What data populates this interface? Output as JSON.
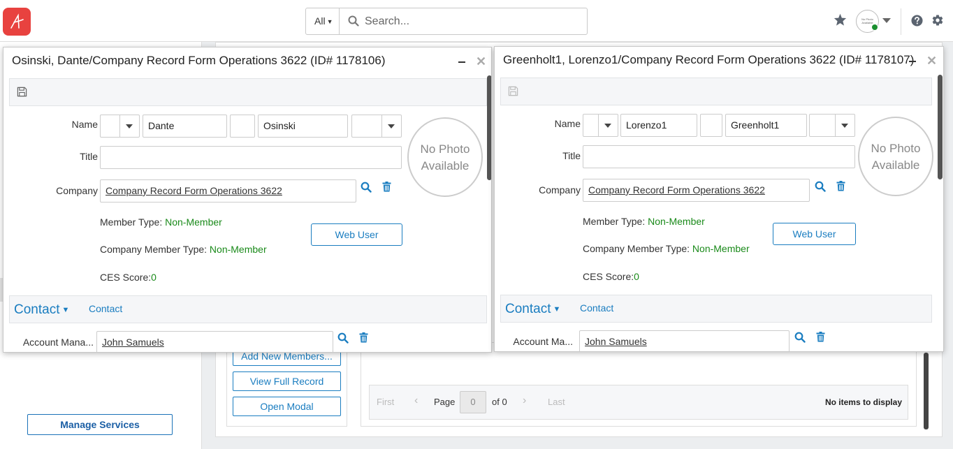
{
  "header": {
    "search_scope": "All",
    "search_placeholder": "Search...",
    "avatar_text": "No Photo Available",
    "colors": {
      "brand": "#e8423f",
      "link": "#1a7dc0",
      "status_online": "#1a8f2f"
    }
  },
  "sidebar": {
    "manage_services_label": "Manage Services"
  },
  "actions": {
    "add_new_members_label": "Add New Members...",
    "view_full_record_label": "View Full Record",
    "open_modal_label": "Open Modal"
  },
  "pager": {
    "first": "First",
    "prev": "‹",
    "page_label": "Page",
    "page_value": "0",
    "of_label": "of 0",
    "next": "›",
    "last": "Last",
    "empty_text": "No items to display"
  },
  "modals": [
    {
      "title": "Osinski, Dante/Company Record Form Operations 3622 (ID# 1178106)",
      "labels": {
        "name": "Name",
        "title": "Title",
        "company": "Company",
        "account_manager": "Account Mana..."
      },
      "first_name": "Dante",
      "last_name": "Osinski",
      "title_value": "",
      "company": "Company Record Form Operations 3622",
      "photo_text": "No Photo Available",
      "member_type_label": "Member Type:",
      "member_type": "Non-Member",
      "company_member_type_label": "Company Member Type:",
      "company_member_type": "Non-Member",
      "ces_score_label": "CES Score:",
      "ces_score": "0",
      "web_user_label": "Web User",
      "section_title": "Contact",
      "section_link": "Contact",
      "account_manager": "John Samuels"
    },
    {
      "title": "Greenholt1, Lorenzo1/Company Record Form Operations 3622 (ID# 1178107)",
      "labels": {
        "name": "Name",
        "title": "Title",
        "company": "Company",
        "account_manager": "Account Ma..."
      },
      "first_name": "Lorenzo1",
      "last_name": "Greenholt1",
      "title_value": "",
      "company": "Company Record Form Operations 3622",
      "photo_text": "No Photo Available",
      "member_type_label": "Member Type:",
      "member_type": "Non-Member",
      "company_member_type_label": "Company Member Type:",
      "company_member_type": "Non-Member",
      "ces_score_label": "CES Score:",
      "ces_score": "0",
      "web_user_label": "Web User",
      "section_title": "Contact",
      "section_link": "Contact",
      "account_manager": "John Samuels"
    }
  ]
}
